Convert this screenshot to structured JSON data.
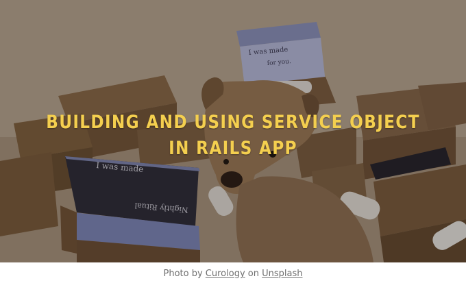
{
  "hero": {
    "title_line1": "BUILDING AND USING SERVICE OBJECT",
    "title_line2": "IN RAILS APP",
    "title_color": "#f4cf4f",
    "box_card_text1": "I was made",
    "box_card_text2": "for you.",
    "box_lid_text": "I was made",
    "box_inner_text": "Nightly Ritual"
  },
  "caption": {
    "prefix": "Photo by",
    "author": "Curology",
    "middle": "on",
    "source": "Unsplash"
  }
}
